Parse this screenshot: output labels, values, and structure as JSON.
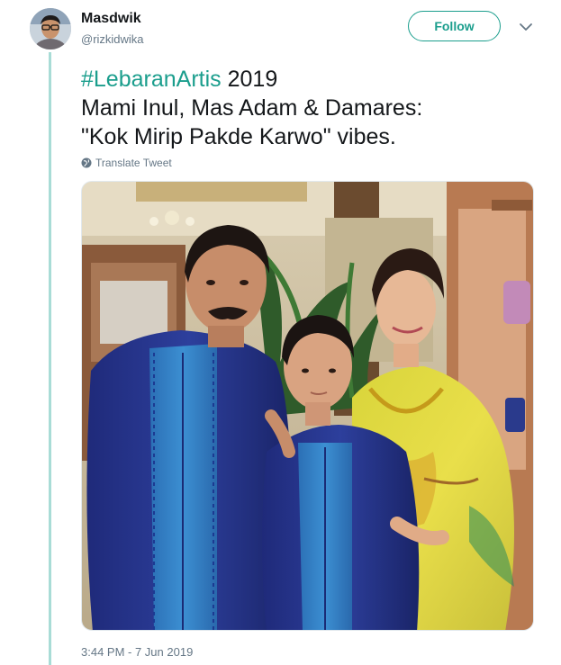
{
  "author": {
    "display_name": "Masdwik",
    "handle": "@rizkidwika"
  },
  "follow_label": "Follow",
  "tweet": {
    "hashtag": "#LebaranArtis",
    "year": " 2019",
    "line2": "Mami Inul, Mas Adam & Damares:",
    "line3": "\"Kok Mirip Pakde Karwo\" vibes."
  },
  "translate_label": "Translate Tweet",
  "timestamp": "3:44 PM - 7 Jun 2019",
  "colors": {
    "accent": "#1b9e8d",
    "thread_line": "#a8dcd6",
    "secondary_text": "#657786"
  }
}
